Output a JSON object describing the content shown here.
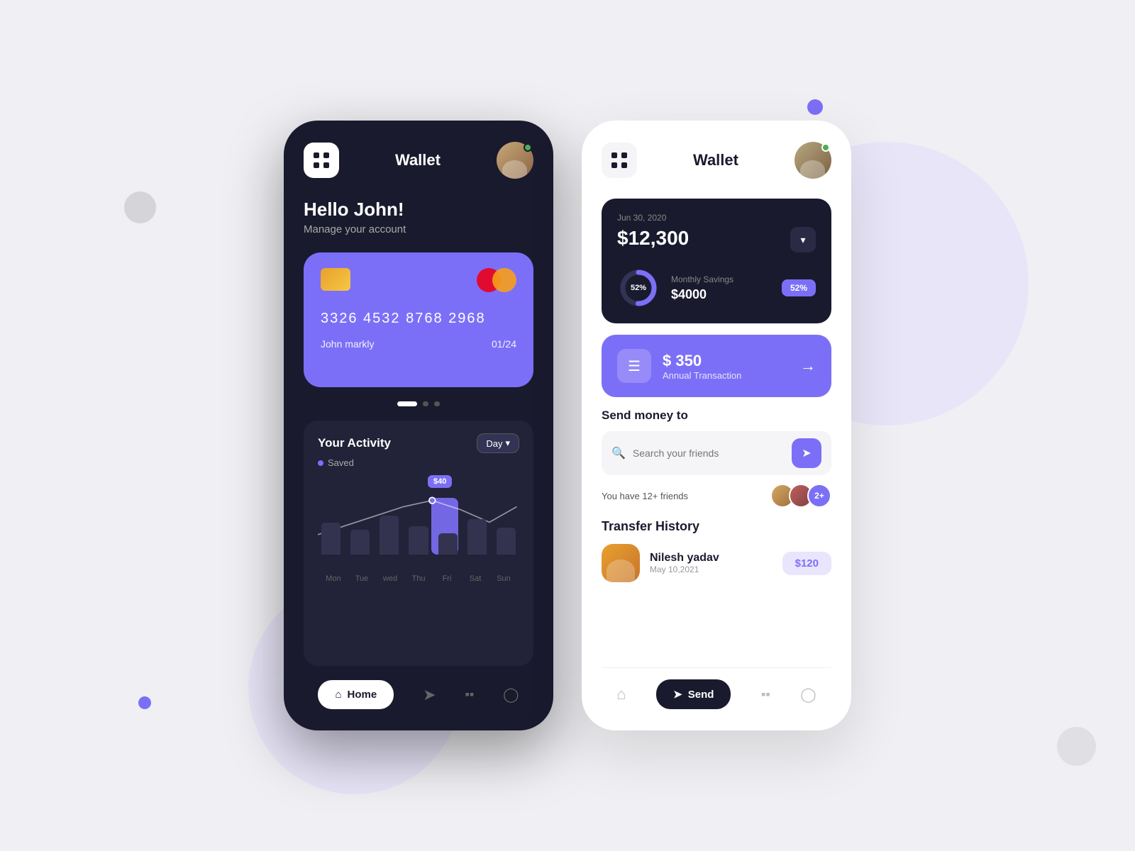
{
  "background": {
    "color": "#f0f0f4"
  },
  "dark_phone": {
    "title": "Wallet",
    "greeting": "Hello John!",
    "subtitle": "Manage your account",
    "card": {
      "number": "3326 4532 8768 2968",
      "name": "John markly",
      "expiry": "01/24"
    },
    "activity": {
      "title": "Your Activity",
      "dropdown": "Day",
      "saved_label": "Saved",
      "highlight_value": "$40",
      "days": [
        "Mon",
        "Tue",
        "wed",
        "Thu",
        "Fri",
        "Sat",
        "Sun"
      ]
    },
    "nav": {
      "home": "Home",
      "send_icon": "➤",
      "wallet_icon": "⬛",
      "profile_icon": "👤"
    }
  },
  "light_phone": {
    "title": "Wallet",
    "balance_card": {
      "date": "Jun 30, 2020",
      "amount": "$12,300",
      "monthly_savings_label": "Monthly Savings",
      "monthly_savings_amount": "$4000",
      "progress_percent": "52%",
      "progress_value": 52
    },
    "transaction": {
      "amount": "$ 350",
      "label": "Annual Transaction"
    },
    "send_money": {
      "title": "Send money to",
      "search_placeholder": "Search your friends",
      "friends_text": "You have 12+ friends",
      "friends_count": "2+"
    },
    "transfer_history": {
      "title": "Transfer History",
      "items": [
        {
          "name": "Nilesh yadav",
          "date": "May 10,2021",
          "amount": "$120"
        }
      ]
    },
    "nav": {
      "home_icon": "⌂",
      "send": "Send",
      "wallet_icon": "⬛",
      "profile_icon": "👤"
    }
  }
}
